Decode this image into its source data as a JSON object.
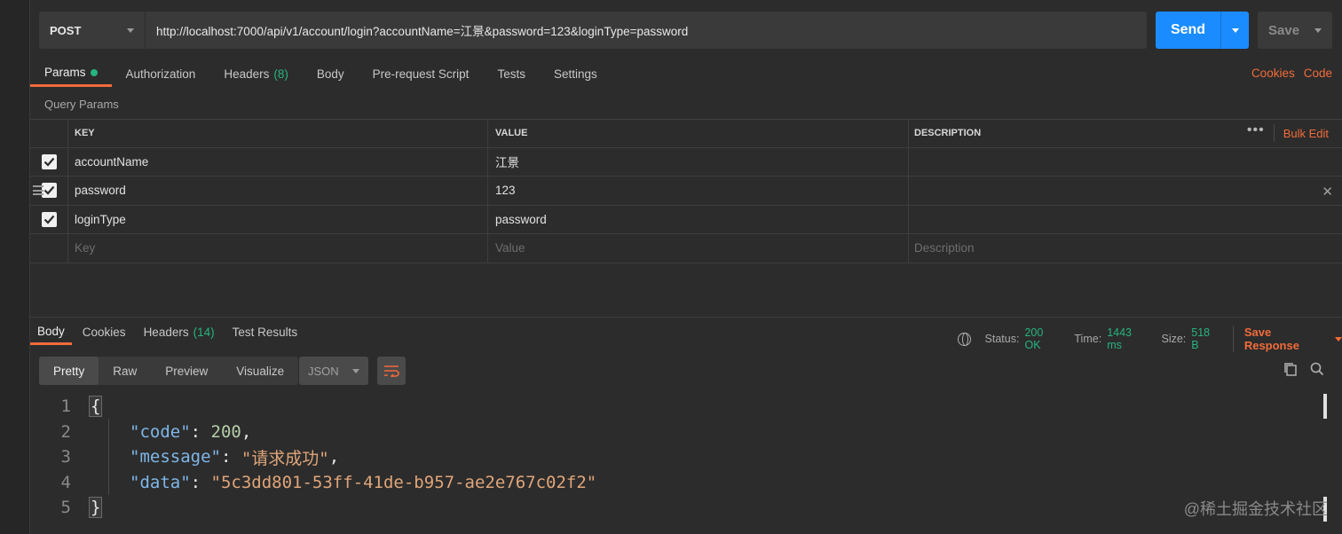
{
  "request": {
    "method": "POST",
    "url": "http://localhost:7000/api/v1/account/login?accountName=江景&password=123&loginType=password",
    "send_label": "Send",
    "save_label": "Save"
  },
  "req_tabs": [
    {
      "label": "Params",
      "active": true
    },
    {
      "label": "Authorization"
    },
    {
      "label": "Headers",
      "count": "(8)"
    },
    {
      "label": "Body"
    },
    {
      "label": "Pre-request Script"
    },
    {
      "label": "Tests"
    },
    {
      "label": "Settings"
    }
  ],
  "right_links": {
    "cookies": "Cookies",
    "code": "Code"
  },
  "query_params": {
    "title": "Query Params",
    "headers": {
      "key": "KEY",
      "value": "VALUE",
      "description": "DESCRIPTION"
    },
    "more": "•••",
    "bulk_edit": "Bulk Edit",
    "rows": [
      {
        "key": "accountName",
        "value": "江景",
        "description": "",
        "checked": true
      },
      {
        "key": "password",
        "value": "123",
        "description": "",
        "checked": true
      },
      {
        "key": "loginType",
        "value": "password",
        "description": "",
        "checked": true
      }
    ],
    "placeholders": {
      "key": "Key",
      "value": "Value",
      "description": "Description"
    }
  },
  "resp_tabs": [
    {
      "label": "Body",
      "active": true
    },
    {
      "label": "Cookies"
    },
    {
      "label": "Headers",
      "count": "(14)"
    },
    {
      "label": "Test Results"
    }
  ],
  "status": {
    "status_label": "Status:",
    "status_value": "200 OK",
    "time_label": "Time:",
    "time_value": "1443 ms",
    "size_label": "Size:",
    "size_value": "518 B",
    "save_response": "Save Response"
  },
  "format": {
    "pretty": "Pretty",
    "raw": "Raw",
    "preview": "Preview",
    "visualize": "Visualize",
    "lang": "JSON"
  },
  "response_body": {
    "line_numbers": [
      "1",
      "2",
      "3",
      "4",
      "5"
    ],
    "open": "{",
    "close": "}",
    "code_key": "\"code\"",
    "code_val": "200",
    "message_key": "\"message\"",
    "message_val": "\"请求成功\"",
    "data_key": "\"data\"",
    "data_val": "\"5c3dd801-53ff-41de-b957-ae2e767c02f2\""
  },
  "watermark": "@稀土掘金技术社区",
  "colors": {
    "accent": "#f26b3a",
    "send": "#1a8cff",
    "success": "#26b47f"
  }
}
